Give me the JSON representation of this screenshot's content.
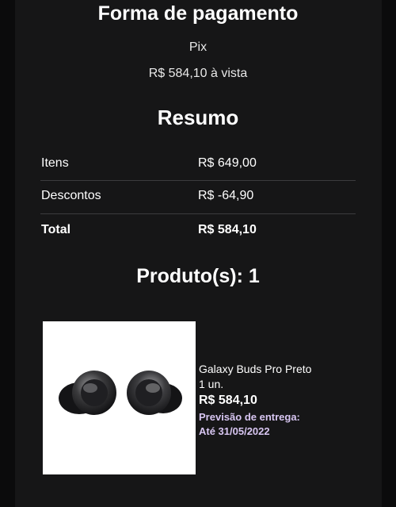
{
  "payment": {
    "title": "Forma de pagamento",
    "method": "Pix",
    "amount_text": "R$ 584,10 à vista"
  },
  "summary": {
    "title": "Resumo",
    "rows": [
      {
        "label": "Itens",
        "value": "R$ 649,00"
      },
      {
        "label": "Descontos",
        "value": "R$ -64,90"
      },
      {
        "label": "Total",
        "value": "R$ 584,10"
      }
    ]
  },
  "products": {
    "title": "Produto(s): 1",
    "items": [
      {
        "name": "Galaxy Buds Pro Preto",
        "quantity": "1 un.",
        "price": "R$ 584,10",
        "delivery_label": "Previsão de entrega:",
        "delivery_date": "Até 31/05/2022"
      }
    ]
  },
  "colors": {
    "background": "#0b0b0c",
    "panel": "#161617",
    "text": "#ffffff",
    "delivery_accent": "#d8c6f2",
    "divider": "#3b3b3e"
  }
}
